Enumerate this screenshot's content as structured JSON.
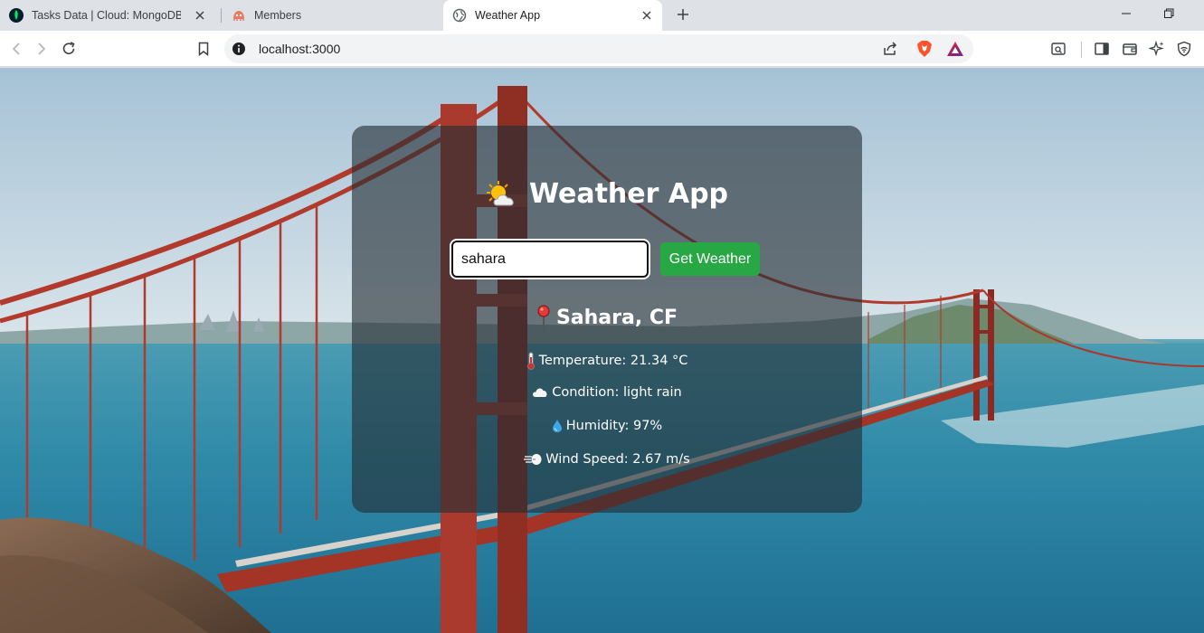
{
  "browser": {
    "tabs": [
      {
        "title": "Tasks Data | Cloud: MongoDB Clo",
        "icon": "mongodb-leaf-icon"
      },
      {
        "title": "Members",
        "icon": "members-favicon-icon"
      },
      {
        "title": "Weather App",
        "icon": "globe-icon",
        "active": true
      }
    ],
    "url": "localhost:3000"
  },
  "app": {
    "title": "Weather App",
    "title_icon": "sun-behind-cloud-icon",
    "search": {
      "value": "sahara",
      "button_label": "Get Weather"
    },
    "result": {
      "city": "Sahara, CF",
      "temperature": "Temperature: 21.34 °C",
      "condition": "Condition: light rain",
      "humidity": "Humidity: 97%",
      "wind": "Wind Speed: 2.67 m/s"
    }
  },
  "colors": {
    "button": "#28a745",
    "card": "#232d34",
    "accent_red": "#c0392b"
  }
}
